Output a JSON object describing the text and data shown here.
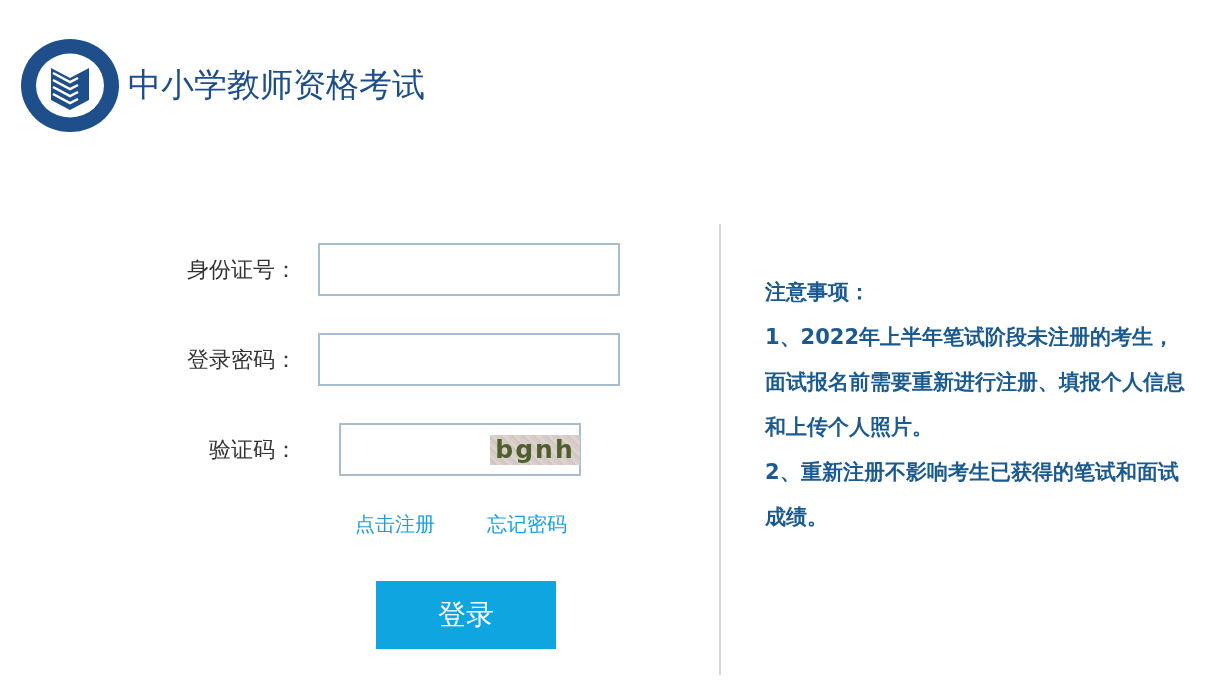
{
  "header": {
    "title": "中小学教师资格考试"
  },
  "login_form": {
    "fields": [
      {
        "kind": "text",
        "label": "身份证号："
      },
      {
        "kind": "password",
        "label": "登录密码："
      },
      {
        "kind": "captcha",
        "label": "验证码：",
        "captcha": "bgnh"
      }
    ],
    "links": [
      "点击注册",
      "忘记密码"
    ],
    "submit_button": "登录"
  },
  "notice": {
    "title": "注意事项：",
    "items": [
      "1、2022年上半年笔试阶段未注册的考生，面试报名前需要重新进行注册、填报个人信息和上传个人照片。",
      "2、重新注册不影响考生已获得的笔试和面试成绩。"
    ]
  }
}
